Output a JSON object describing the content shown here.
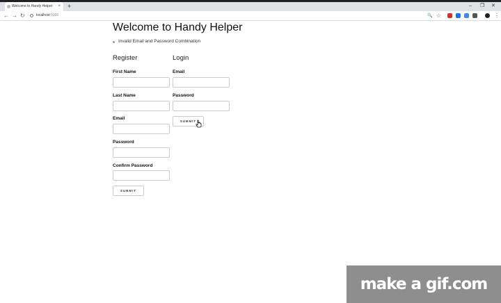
{
  "browser": {
    "tab_title": "Welcome to Handy Helper",
    "tab_close": "×",
    "new_tab": "+",
    "url_host": "localhost",
    "url_port": ":5000",
    "controls": {
      "minimize": "–",
      "maximize": "❐",
      "close": "✕"
    },
    "nav": {
      "back": "←",
      "forward": "→",
      "reload": "↻"
    },
    "icons": {
      "zoom": "🔍",
      "star": "☆",
      "menu": "⋮"
    },
    "extension_colors": [
      "#d93025",
      "#1a73e8",
      "#4285f4",
      "#555555",
      "#202124"
    ]
  },
  "page": {
    "title": "Welcome to Handy Helper",
    "errors": [
      "Invalid Email and Password Combination"
    ]
  },
  "register": {
    "heading": "Register",
    "first_name_label": "First Name",
    "last_name_label": "Last Name",
    "email_label": "Email",
    "password_label": "Password",
    "confirm_password_label": "Confirm Password",
    "submit_label": "SUBMIT"
  },
  "login": {
    "heading": "Login",
    "email_label": "Email",
    "password_label": "Password",
    "submit_label": "SUBMIT"
  },
  "watermark": "make a gif.com"
}
